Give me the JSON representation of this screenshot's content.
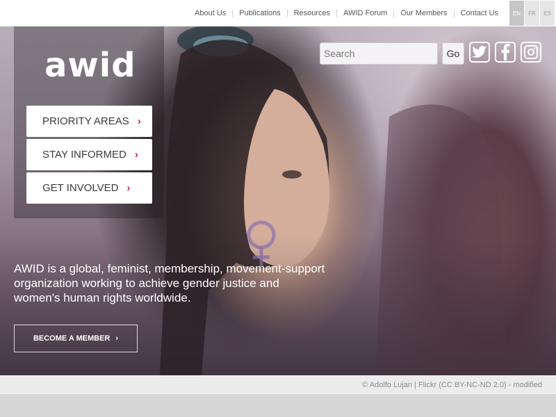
{
  "topnav": {
    "links": [
      "About Us",
      "Publications",
      "Resources",
      "AWID Forum",
      "Our Members",
      "Contact Us"
    ]
  },
  "languages": [
    {
      "code": "EN",
      "active": true
    },
    {
      "code": "FR",
      "active": false
    },
    {
      "code": "ES",
      "active": false
    }
  ],
  "logo": {
    "text": "awid"
  },
  "menu": {
    "items": [
      "PRIORITY AREAS",
      "STAY INFORMED",
      "GET INVOLVED"
    ],
    "chevron": "›"
  },
  "search": {
    "placeholder": "Search",
    "go_label": "Go"
  },
  "social": {
    "icons": [
      "twitter-icon",
      "facebook-icon",
      "instagram-icon"
    ]
  },
  "hero": {
    "tagline": "AWID is a global, feminist, membership, movement-support organization working to achieve gender justice and women's human rights worldwide.",
    "cta_label": "BECOME A MEMBER",
    "cta_chevron": "›"
  },
  "credit": {
    "text": "© Adolfo Lujan | Flickr (CC BY-NC-ND 2.0) - modified"
  },
  "colors": {
    "accent": "#c2186b",
    "white": "#ffffff"
  }
}
